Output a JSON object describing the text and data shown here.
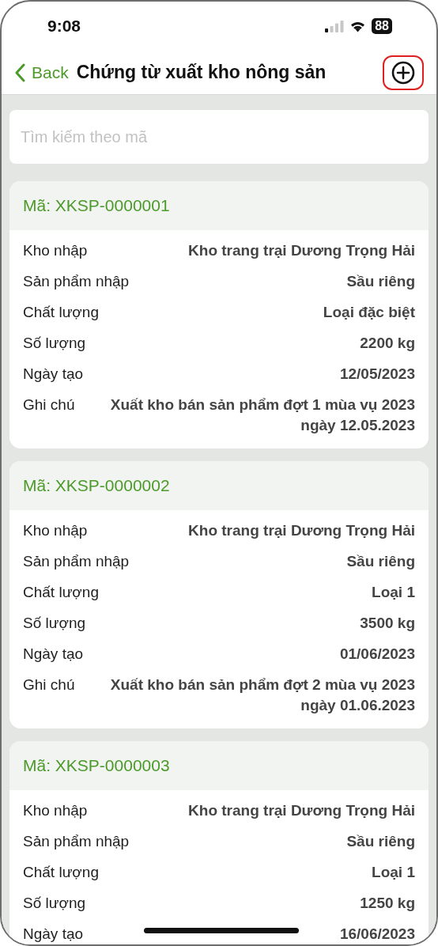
{
  "status_bar": {
    "time": "9:08",
    "battery": "88"
  },
  "nav": {
    "back": "Back",
    "title": "Chứng từ xuất kho nông sản",
    "add_highlighted": true
  },
  "search": {
    "placeholder": "Tìm kiếm theo mã"
  },
  "cards": [
    {
      "code": "Mã: XKSP-0000001",
      "rows": [
        {
          "label": "Kho nhập",
          "value": "Kho trang trại Dương Trọng Hải"
        },
        {
          "label": "Sản phẩm nhập",
          "value": "Sầu riêng"
        },
        {
          "label": "Chất lượng",
          "value": "Loại đặc biệt"
        },
        {
          "label": "Số lượng",
          "value": "2200 kg"
        },
        {
          "label": "Ngày tạo",
          "value": "12/05/2023"
        },
        {
          "label": "Ghi chú",
          "value": "Xuất kho bán sản phẩm đợt 1 mùa vụ 2023 ngày 12.05.2023"
        }
      ]
    },
    {
      "code": "Mã: XKSP-0000002",
      "rows": [
        {
          "label": "Kho nhập",
          "value": "Kho trang trại Dương Trọng Hải"
        },
        {
          "label": "Sản phẩm nhập",
          "value": "Sầu riêng"
        },
        {
          "label": "Chất lượng",
          "value": "Loại 1"
        },
        {
          "label": "Số lượng",
          "value": "3500 kg"
        },
        {
          "label": "Ngày tạo",
          "value": "01/06/2023"
        },
        {
          "label": "Ghi chú",
          "value": "Xuất kho bán sản phẩm đợt 2 mùa vụ 2023 ngày 01.06.2023"
        }
      ]
    },
    {
      "code": "Mã: XKSP-0000003",
      "rows": [
        {
          "label": "Kho nhập",
          "value": "Kho trang trại Dương Trọng Hải"
        },
        {
          "label": "Sản phẩm nhập",
          "value": "Sầu riêng"
        },
        {
          "label": "Chất lượng",
          "value": "Loại 1"
        },
        {
          "label": "Số lượng",
          "value": "1250 kg"
        },
        {
          "label": "Ngày tạo",
          "value": "16/06/2023"
        }
      ]
    }
  ]
}
